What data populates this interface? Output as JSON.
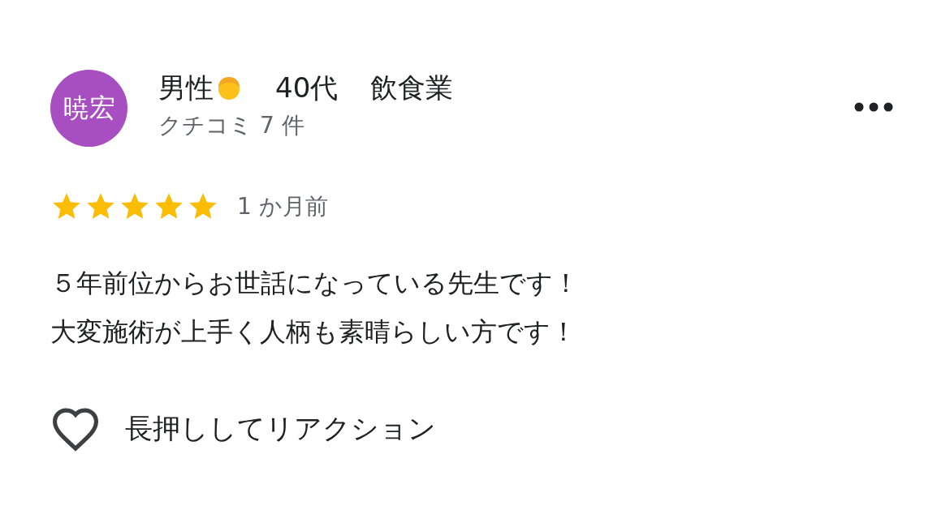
{
  "reviewer": {
    "avatar_text": "暁宏",
    "gender": "男性",
    "age": "40代",
    "industry": "飲食業",
    "review_count": "クチコミ 7 件"
  },
  "rating": {
    "stars": 5,
    "time": "1 か月前"
  },
  "body": [
    "５年前位からお世話になっている先生です！",
    "大変施術が上手く人柄も素晴らしい方です！"
  ],
  "reaction": {
    "label": "長押ししてリアクション"
  }
}
